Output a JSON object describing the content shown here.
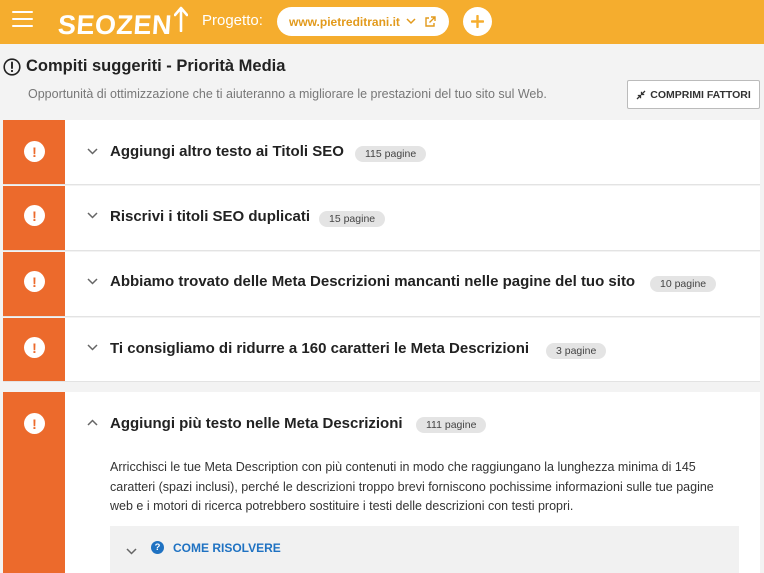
{
  "topbar": {
    "logo_text": "SEOZEN",
    "progetto_label": "Progetto:",
    "project_site": "www.pietreditrani.it",
    "menu_icon": "hamburger-icon",
    "add_icon": "plus-icon",
    "external_icon": "external-link-icon",
    "accent": "#f5ad2e"
  },
  "section": {
    "title": "Compiti suggeriti - Priorità Media",
    "subtitle": "Opportunità di ottimizzazione che ti aiuteranno a migliorare le prestazioni del tuo sito sul Web.",
    "compress_button": "COMPRIMI FATTORI"
  },
  "tasks": [
    {
      "title": "Aggiungi altro testo ai Titoli SEO",
      "badge": "115 pagine",
      "expanded": false
    },
    {
      "title": "Riscrivi i titoli SEO duplicati",
      "badge": "15 pagine",
      "expanded": false
    },
    {
      "title": "Abbiamo trovato delle Meta Descrizioni mancanti nelle pagine del tuo sito",
      "badge": "10 pagine",
      "expanded": false
    },
    {
      "title": "Ti consigliamo di ridurre a 160 caratteri le Meta Descrizioni",
      "badge": "3 pagine",
      "expanded": false
    },
    {
      "title": "Aggiungi più testo nelle Meta Descrizioni",
      "badge": "111 pagine",
      "expanded": true,
      "description": "Arricchisci le tue Meta Description con più contenuti in modo che raggiungano la lunghezza minima di 145 caratteri (spazi inclusi), perché le descrizioni troppo brevi forniscono pochissime informazioni sulle tue pagine web e i motori di ricerca potrebbero sostituire i testi delle descrizioni con testi propri.",
      "how_to_fix": "COME RISOLVERE"
    }
  ],
  "colors": {
    "priority_flag": "#ec6a2c",
    "link_blue": "#1f72c2"
  }
}
